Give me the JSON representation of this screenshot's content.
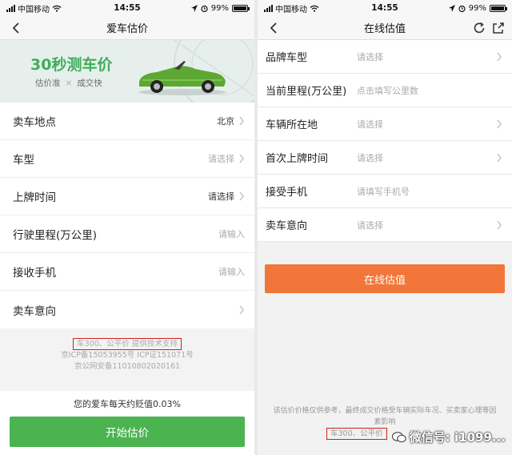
{
  "left": {
    "status": {
      "carrier": "中国移动",
      "time": "14:55",
      "battery": "99%"
    },
    "title": "爱车估价",
    "banner": {
      "title": "30秒测车价",
      "tag1": "估价准",
      "sep": "×",
      "tag2": "成交快"
    },
    "rows": [
      {
        "label": "卖车地点",
        "value": "北京"
      },
      {
        "label": "车型",
        "value": "请选择"
      },
      {
        "label": "上牌时间",
        "value": "请选择"
      },
      {
        "label": "行驶里程(万公里)",
        "value": "请输入"
      },
      {
        "label": "接收手机",
        "value": "请输入"
      },
      {
        "label": "卖车意向",
        "value": ""
      }
    ],
    "footer": {
      "support": "车300、公平价 提供技术支持",
      "icp": "京ICP备15053955号 ICP证151071号",
      "police": "京公网安备11010802020161"
    },
    "note": "您的爱车每天约贬值0.03%",
    "button": "开始估价"
  },
  "right": {
    "status": {
      "carrier": "中国移动",
      "time": "14:55",
      "battery": "99%"
    },
    "title": "在线估值",
    "rows": [
      {
        "label": "品牌车型",
        "placeholder": "请选择"
      },
      {
        "label": "当前里程(万公里)",
        "placeholder": "点击填写公里数"
      },
      {
        "label": "车辆所在地",
        "placeholder": "请选择"
      },
      {
        "label": "首次上牌时间",
        "placeholder": "请选择"
      },
      {
        "label": "接受手机",
        "placeholder": "请填写手机号"
      },
      {
        "label": "卖车意向",
        "placeholder": "请选择"
      }
    ],
    "button": "在线估值",
    "disclaimer": "该估价价格仅供参考，最终成交价格受车辆实际车况、买卖家心理等因素影响",
    "support": "车300、公平价",
    "watermark": "微信号: i1099..."
  },
  "colors": {
    "green": "#4cb351",
    "orange": "#f2763a",
    "red_box": "#d0201f"
  }
}
